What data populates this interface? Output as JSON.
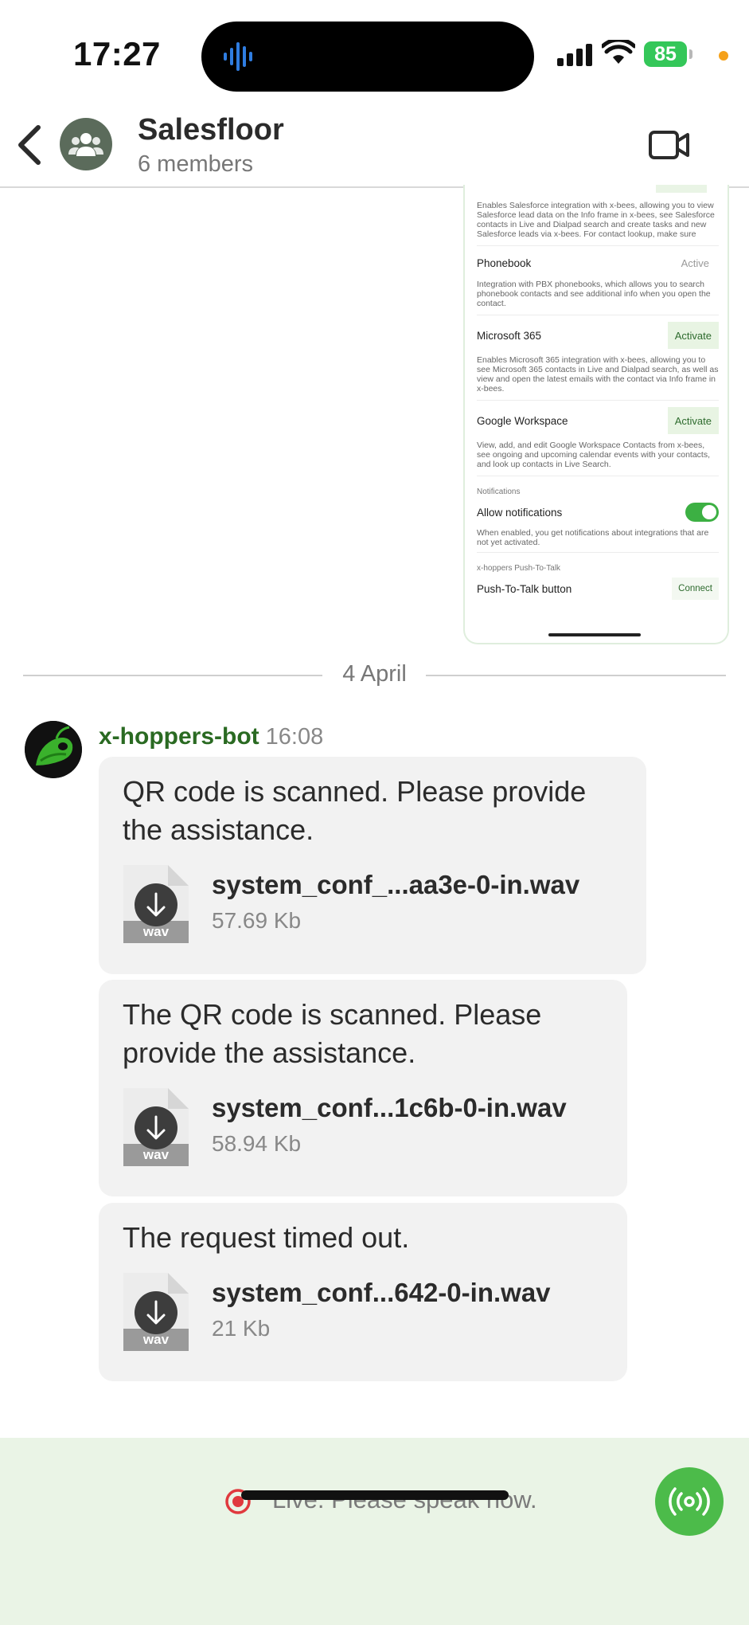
{
  "status_bar": {
    "time": "17:27",
    "battery": "85"
  },
  "header": {
    "title": "Salesfloor",
    "subtitle": "6 members"
  },
  "screenshot": {
    "salesforce_desc": "Enables Salesforce integration with x-bees, allowing you to view Salesforce lead data on the Info frame in x-bees, see Salesforce contacts in Live and Dialpad search and create tasks and new Salesforce leads via x-bees. For contact lookup, make sure",
    "phonebook_label": "Phonebook",
    "phonebook_status": "Active",
    "phonebook_desc": "Integration with PBX phonebooks, which allows you to search phonebook contacts and see additional info when you open the contact.",
    "ms365_label": "Microsoft 365",
    "ms365_button": "Activate",
    "ms365_desc": "Enables Microsoft 365 integration with x-bees, allowing you to see Microsoft 365 contacts in Live and Dialpad search, as well as view and open the latest emails with the contact via Info frame in x-bees.",
    "google_label": "Google Workspace",
    "google_button": "Activate",
    "google_desc": "View, add, and edit Google Workspace Contacts from x-bees, see ongoing and upcoming calendar events with your contacts, and look up contacts in Live Search.",
    "notifications_caption": "Notifications",
    "allow_label": "Allow notifications",
    "allow_desc": "When enabled, you get notifications about integrations that are not yet activated.",
    "ptt_caption": "x-hoppers Push-To-Talk",
    "ptt_label": "Push-To-Talk button",
    "ptt_button": "Connect"
  },
  "date_separator": "4 April",
  "message": {
    "sender": "x-hoppers-bot",
    "time": "16:08",
    "items": [
      {
        "text_line1": "QR code is scanned. Please provide",
        "text_line2": "the assistance.",
        "file_name": "system_conf_...aa3e-0-in.wav",
        "file_size": "57.69 Kb",
        "file_ext": "wav"
      },
      {
        "text_line1": "The QR code is scanned. Please",
        "text_line2": "provide the assistance.",
        "file_name": "system_conf...1c6b-0-in.wav",
        "file_size": "58.94 Kb",
        "file_ext": "wav"
      },
      {
        "text_line1": "The request timed out.",
        "file_name": "system_conf...642-0-in.wav",
        "file_size": "21 Kb",
        "file_ext": "wav"
      }
    ]
  },
  "bottom_bar": {
    "live_text": "Live. Please speak now."
  },
  "colors": {
    "accent_green": "#4cbb4a",
    "sender_green": "#2a6a22",
    "bubble_bg": "#f2f2f2",
    "bottom_bg": "#eaf4e6",
    "record_red": "#e0393e"
  }
}
